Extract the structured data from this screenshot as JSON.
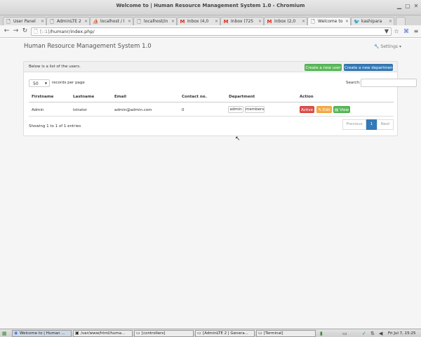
{
  "window": {
    "title": "Welcome to | Human Resource Management System 1.0 - Chromium"
  },
  "tabs": [
    {
      "label": "User Panel",
      "icon": "document-icon",
      "active": false
    },
    {
      "label": "AdminLTE 2",
      "icon": "document-icon",
      "active": false
    },
    {
      "label": "localhost / l",
      "icon": "phpmyadmin-icon",
      "active": false
    },
    {
      "label": "localhost/in",
      "icon": "document-icon",
      "active": false
    },
    {
      "label": "Inbox (4,0",
      "icon": "gmail-icon",
      "active": false
    },
    {
      "label": "Inbox (725",
      "icon": "gmail-icon",
      "active": false
    },
    {
      "label": "Inbox (2,0",
      "icon": "gmail-icon",
      "active": false
    },
    {
      "label": "Welcome to",
      "icon": "document-icon",
      "active": true
    },
    {
      "label": "kashipara",
      "icon": "bird-icon",
      "active": false
    }
  ],
  "address": {
    "host": "[::1]",
    "path": "/humanr/index.php/"
  },
  "app": {
    "brand": "Human Resource Management System 1.0",
    "settings_label": "Settings"
  },
  "panel": {
    "note": "Below is a list of the users.",
    "create_user_label": "Create a new user",
    "create_department_label": "Create a new department",
    "length_value": "50",
    "length_label": "records per page",
    "search_label": "Search:"
  },
  "table": {
    "headers": [
      "Firstname",
      "Lastname",
      "Email",
      "Contact no.",
      "Department",
      "Action"
    ],
    "rows": [
      {
        "firstname": "Admin",
        "lastname": "Istrator",
        "email": "admin@admin.com",
        "contact": "0",
        "departments": [
          "admin",
          "members"
        ],
        "actions": {
          "active": "Active",
          "edit": "Edit",
          "view": "View"
        }
      }
    ]
  },
  "footer": {
    "info": "Showing 1 to 1 of 1 entries",
    "previous": "Previous",
    "page": "1",
    "next": "Next"
  },
  "taskbar": {
    "tasks": [
      {
        "label": "Welcome to | Human ...",
        "active": true
      },
      {
        "label": "/var/www/html/huma...",
        "active": false
      },
      {
        "label": "[controllers]",
        "active": false
      },
      {
        "label": "[AdminLTE 2 | Genera...",
        "active": false
      },
      {
        "label": "[Terminal]",
        "active": false
      }
    ],
    "clock": "Fri Jul 7, 15:25"
  },
  "colors": {
    "success": "#5cb85c",
    "primary": "#337ab7",
    "danger": "#d9534f",
    "warning": "#f0ad4e"
  }
}
